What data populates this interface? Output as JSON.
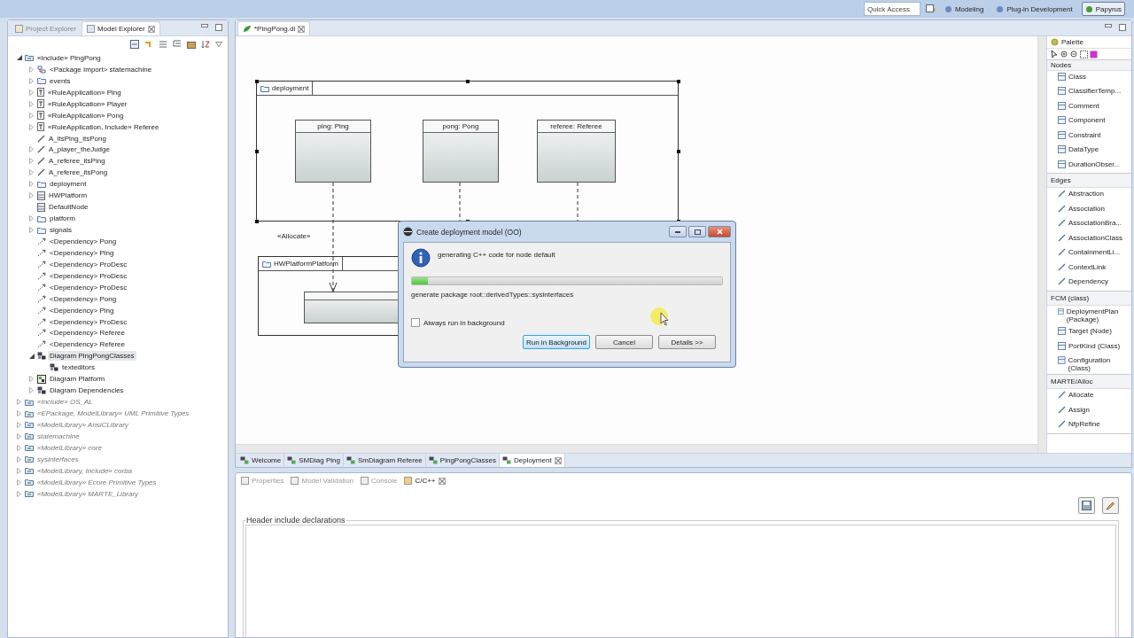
{
  "top_bar": {
    "quick_access": {
      "placeholder": "Quick Access"
    },
    "perspectives": [
      {
        "label": "Modeling",
        "selected": false
      },
      {
        "label": "Plug-in Development",
        "selected": false
      },
      {
        "label": "Papyrus",
        "selected": true
      }
    ]
  },
  "left_panel": {
    "tabs": [
      {
        "label": "Project Explorer",
        "selected": false
      },
      {
        "label": "Model Explorer",
        "selected": true
      }
    ],
    "tree": [
      {
        "label": "«Include» PingPong",
        "kind": "package",
        "expanded": true,
        "selected": false,
        "imported": false,
        "children": [
          {
            "label": "<Package Import> statemachine",
            "kind": "import",
            "expanded": false,
            "selected": false
          },
          {
            "label": "events",
            "kind": "folder",
            "expanded": false,
            "selected": false
          },
          {
            "label": "«RuleApplication» Ping",
            "kind": "rule",
            "expanded": false,
            "selected": false
          },
          {
            "label": "«RuleApplication» Player",
            "kind": "rule",
            "expanded": false,
            "selected": false
          },
          {
            "label": "«RuleApplication» Pong",
            "kind": "rule",
            "expanded": false,
            "selected": false
          },
          {
            "label": "«RuleApplication, Include» Referee",
            "kind": "rule",
            "expanded": false,
            "selected": false
          },
          {
            "label": "A_itsPing_itsPong",
            "kind": "association",
            "selected": false
          },
          {
            "label": "A_player_theJudge",
            "kind": "association",
            "expanded": false,
            "selected": false
          },
          {
            "label": "A_referee_itsPing",
            "kind": "association",
            "expanded": false,
            "selected": false
          },
          {
            "label": "A_referee_itsPong",
            "kind": "association",
            "expanded": false,
            "selected": false
          },
          {
            "label": "deployment",
            "kind": "folder",
            "expanded": false,
            "selected": false
          },
          {
            "label": "HWPlatform",
            "kind": "class",
            "expanded": false,
            "selected": false
          },
          {
            "label": "DefaultNode",
            "kind": "class",
            "selected": false
          },
          {
            "label": "platform",
            "kind": "folder",
            "expanded": false,
            "selected": false
          },
          {
            "label": "signals",
            "kind": "folder",
            "expanded": false,
            "selected": false
          },
          {
            "label": "<Dependency> Pong",
            "kind": "dependency",
            "selected": false
          },
          {
            "label": "<Dependency> Ping",
            "kind": "dependency",
            "selected": false
          },
          {
            "label": "<Dependency> ProDesc",
            "kind": "dependency",
            "selected": false
          },
          {
            "label": "<Dependency> ProDesc",
            "kind": "dependency",
            "selected": false
          },
          {
            "label": "<Dependency> ProDesc",
            "kind": "dependency",
            "selected": false
          },
          {
            "label": "<Dependency> Pong",
            "kind": "dependency",
            "selected": false
          },
          {
            "label": "<Dependency> Ping",
            "kind": "dependency",
            "selected": false
          },
          {
            "label": "<Dependency> ProDesc",
            "kind": "dependency",
            "selected": false
          },
          {
            "label": "<Dependency> Referee",
            "kind": "dependency",
            "selected": false
          },
          {
            "label": "<Dependency> Referee",
            "kind": "dependency",
            "selected": false
          },
          {
            "label": "Diagram PingPongClasses",
            "kind": "diagram",
            "expanded": true,
            "selected": true,
            "children": [
              {
                "label": "texteditors",
                "kind": "diagram",
                "selected": false
              }
            ]
          },
          {
            "label": "Diagram Platform",
            "kind": "diagram-platform",
            "expanded": false,
            "selected": false
          },
          {
            "label": "Diagram Dependencies",
            "kind": "diagram",
            "expanded": false,
            "selected": false
          }
        ]
      },
      {
        "label": "«Include» OS_AL",
        "kind": "package",
        "expanded": false,
        "selected": false,
        "imported": true
      },
      {
        "label": "«EPackage, ModelLibrary» UML Primitive Types",
        "kind": "package",
        "expanded": false,
        "selected": false,
        "imported": true
      },
      {
        "label": "«ModelLibrary» AnsiCLibrary",
        "kind": "package",
        "expanded": false,
        "selected": false,
        "imported": true
      },
      {
        "label": "statemachine",
        "kind": "package",
        "expanded": false,
        "selected": false,
        "imported": true
      },
      {
        "label": "«ModelLibrary» core",
        "kind": "package",
        "expanded": false,
        "selected": false,
        "imported": true
      },
      {
        "label": "sysinterfaces",
        "kind": "package",
        "expanded": false,
        "selected": false,
        "imported": true
      },
      {
        "label": "«ModelLibrary, Include» corba",
        "kind": "package",
        "expanded": false,
        "selected": false,
        "imported": true
      },
      {
        "label": "«ModelLibrary» Ecore Primitive Types",
        "kind": "package",
        "expanded": false,
        "selected": false,
        "imported": true
      },
      {
        "label": "«ModelLibrary» MARTE_Library",
        "kind": "package",
        "expanded": false,
        "selected": false,
        "imported": true
      }
    ]
  },
  "editor": {
    "tab": {
      "label": "*PingPong.di"
    },
    "diagram": {
      "frames": [
        {
          "label": "deployment"
        },
        {
          "label": "HWPlatformPlatform"
        }
      ],
      "nodes": [
        {
          "label": "ping: Ping"
        },
        {
          "label": "pong: Pong"
        },
        {
          "label": "referee: Referee"
        }
      ],
      "allocate_label": "«Allocate»"
    },
    "palette": {
      "title": "Palette",
      "drawers": [
        {
          "name": "Nodes",
          "kind": "nodes",
          "items": [
            "Class",
            "ClassifierTemp...",
            "Comment",
            "Component",
            "Constraint",
            "DataType",
            "DurationObser..."
          ]
        },
        {
          "name": "Edges",
          "kind": "edges",
          "items": [
            "Abstraction",
            "Association",
            "AssociationBra...",
            "AssociationClass",
            "ContainmentLi...",
            "ContextLink",
            "Dependency"
          ]
        },
        {
          "name": "FCM (class)",
          "kind": "nodes",
          "items": [
            "DeploymentPlan (Package)",
            "Target (Node)",
            "PortKind (Class)",
            "Configuration (Class)"
          ]
        },
        {
          "name": "MARTE/Alloc",
          "kind": "edges",
          "items": [
            "Allocate",
            "Assign",
            "NfpRefine"
          ]
        }
      ]
    },
    "diagram_tabs": [
      {
        "label": "Welcome",
        "selected": false
      },
      {
        "label": "SMDiag Ping",
        "selected": false
      },
      {
        "label": "SmDiagram Referee",
        "selected": false
      },
      {
        "label": "PingPongClasses",
        "selected": false
      },
      {
        "label": "Deployment",
        "selected": true
      }
    ]
  },
  "bottom_panel": {
    "tabs": [
      {
        "label": "Properties",
        "selected": false
      },
      {
        "label": "Model Validation",
        "selected": false
      },
      {
        "label": "Console",
        "selected": false
      },
      {
        "label": "C/C++",
        "selected": true
      }
    ],
    "group_label": "Header include declarations"
  },
  "dialog": {
    "title": "Create deployment model (OO)",
    "message": "generating C++ code for node default",
    "progress": {
      "level": 0.05
    },
    "subtask": "generate package root::derivedTypes::sysinterfaces",
    "always_background": {
      "label": "Always run in background",
      "checked": false
    },
    "buttons": [
      {
        "label": "Run in Background",
        "default": true
      },
      {
        "label": "Cancel",
        "default": false
      },
      {
        "label": "Details >>",
        "default": false
      }
    ]
  }
}
